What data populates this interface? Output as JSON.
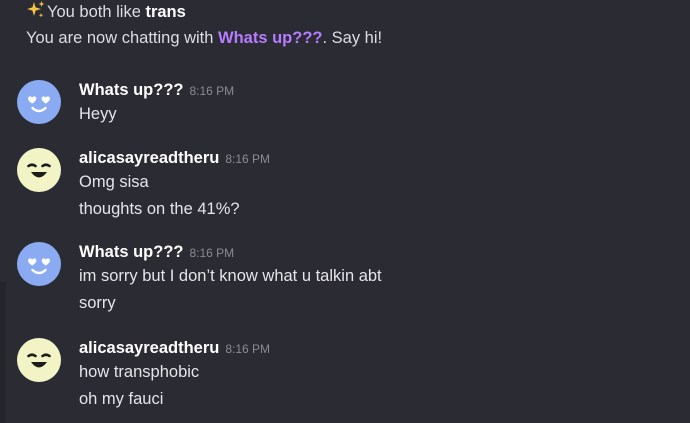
{
  "intro": {
    "like_prefix": "You both like ",
    "like_topic": "trans",
    "chat_prefix": "You are now chatting with ",
    "partner_name": "Whats up???",
    "chat_suffix": ". Say hi!"
  },
  "colors": {
    "background": "#2b2b33",
    "partner_name": "#b57cff",
    "blue_avatar": "#8aaaf2",
    "yellow_avatar": "#f3f4c6"
  },
  "messages": [
    {
      "author": "Whats up???",
      "time": "8:16 PM",
      "avatar_icon": "heart-eyes-blue-avatar-icon",
      "lines": [
        "Heyy"
      ]
    },
    {
      "author": "alicasayreadtheru",
      "time": "8:16 PM",
      "avatar_icon": "smiling-yellow-avatar-icon",
      "lines": [
        "Omg sisa",
        "thoughts on the 41%?"
      ]
    },
    {
      "author": "Whats up???",
      "time": "8:16 PM",
      "avatar_icon": "heart-eyes-blue-avatar-icon",
      "lines": [
        "im sorry but I don’t know what u talkin abt",
        "sorry"
      ]
    },
    {
      "author": "alicasayreadtheru",
      "time": "8:16 PM",
      "avatar_icon": "smiling-yellow-avatar-icon",
      "lines": [
        "how transphobic",
        "oh my fauci"
      ]
    }
  ]
}
